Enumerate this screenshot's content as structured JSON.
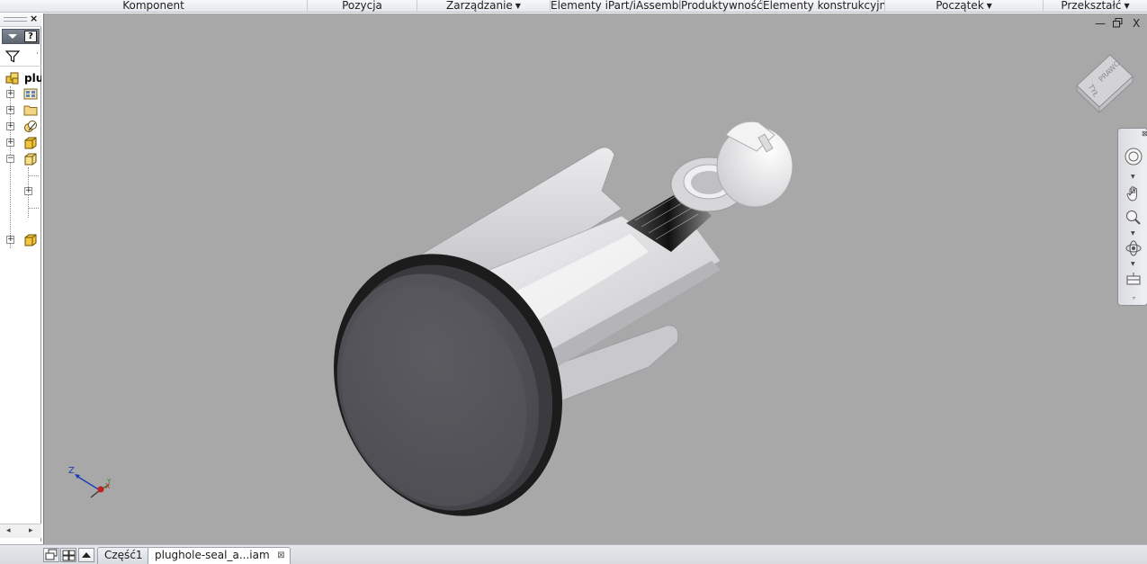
{
  "ribbon": {
    "panels": [
      {
        "label": "Komponent",
        "dropdown": false
      },
      {
        "label": "Pozycja",
        "dropdown": false
      },
      {
        "label": "Zarządzanie",
        "dropdown": true
      },
      {
        "label": "Elementy iPart/iAssembly",
        "dropdown": false
      },
      {
        "label": "Produktywność",
        "dropdown": false
      },
      {
        "label": "Elementy konstrukcyjne",
        "dropdown": false
      },
      {
        "label": "Początek",
        "dropdown": true
      },
      {
        "label": "Przekształć",
        "dropdown": true
      }
    ]
  },
  "browser": {
    "close_glyph": "×",
    "help_glyph": "?",
    "root_label": "plu"
  },
  "viewport": {
    "background": "#a8a8a8",
    "window_controls": {
      "minimize": "—",
      "restore": "▫",
      "close": "X"
    },
    "viewcube": {
      "face_top": "PRAWO",
      "face_front": "TYŁ"
    },
    "triad": {
      "z_label": "Z",
      "x_label": "X",
      "y_label": "Y"
    }
  },
  "tabs": {
    "items": [
      {
        "label": "Część1",
        "active": false
      },
      {
        "label": "plughole-seal_a...iam",
        "active": true
      }
    ],
    "close_glyph": "⊠"
  },
  "colors": {
    "viewport_bg": "#a8a8a8",
    "seal_rubber": "#1c1c1c",
    "plug_cap": "#5a5a5e",
    "body_plastic": "#e4e4e6"
  }
}
